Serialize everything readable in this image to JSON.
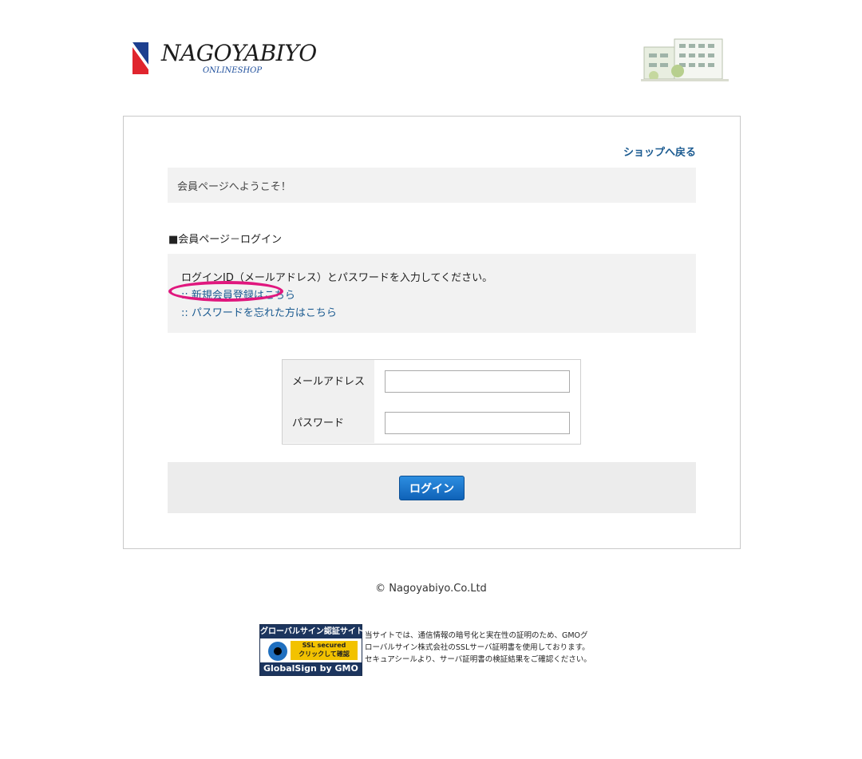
{
  "header": {
    "brand": "NAGOYABIYO",
    "brand_sub": "ONLINESHOP"
  },
  "panel": {
    "back_link": "ショップへ戻る",
    "welcome": "会員ページへようこそ！",
    "section_title": "■会員ページ－ログイン",
    "instructions": "ログインID（メールアドレス）とパスワードを入力してください。",
    "register_link": ":: 新規会員登録はこちら",
    "forgot_link": ":: パスワードを忘れた方はこちら",
    "form": {
      "email_label": "メールアドレス",
      "email_value": "",
      "password_label": "パスワード",
      "password_value": ""
    },
    "login_button": "ログイン"
  },
  "footer": {
    "copyright": "© Nagoyabiyo.Co.Ltd",
    "seal": {
      "top": "グローバルサイン認証サイト",
      "ssl_line1": "SSL secured",
      "ssl_line2": "クリックして確認",
      "bottom": "GlobalSign by GMO"
    },
    "seal_text_1": "当サイトでは、通信情報の暗号化と実在性の証明のため、GMOグ",
    "seal_text_2": "ローバルサイン株式会社のSSLサーバ証明書を使用しております。",
    "seal_text_3": "セキュアシールより、サーバ証明書の検証結果をご確認ください。"
  },
  "colors": {
    "link": "#1a5a90",
    "highlight": "#e0177e",
    "button": "#0f62b8"
  }
}
